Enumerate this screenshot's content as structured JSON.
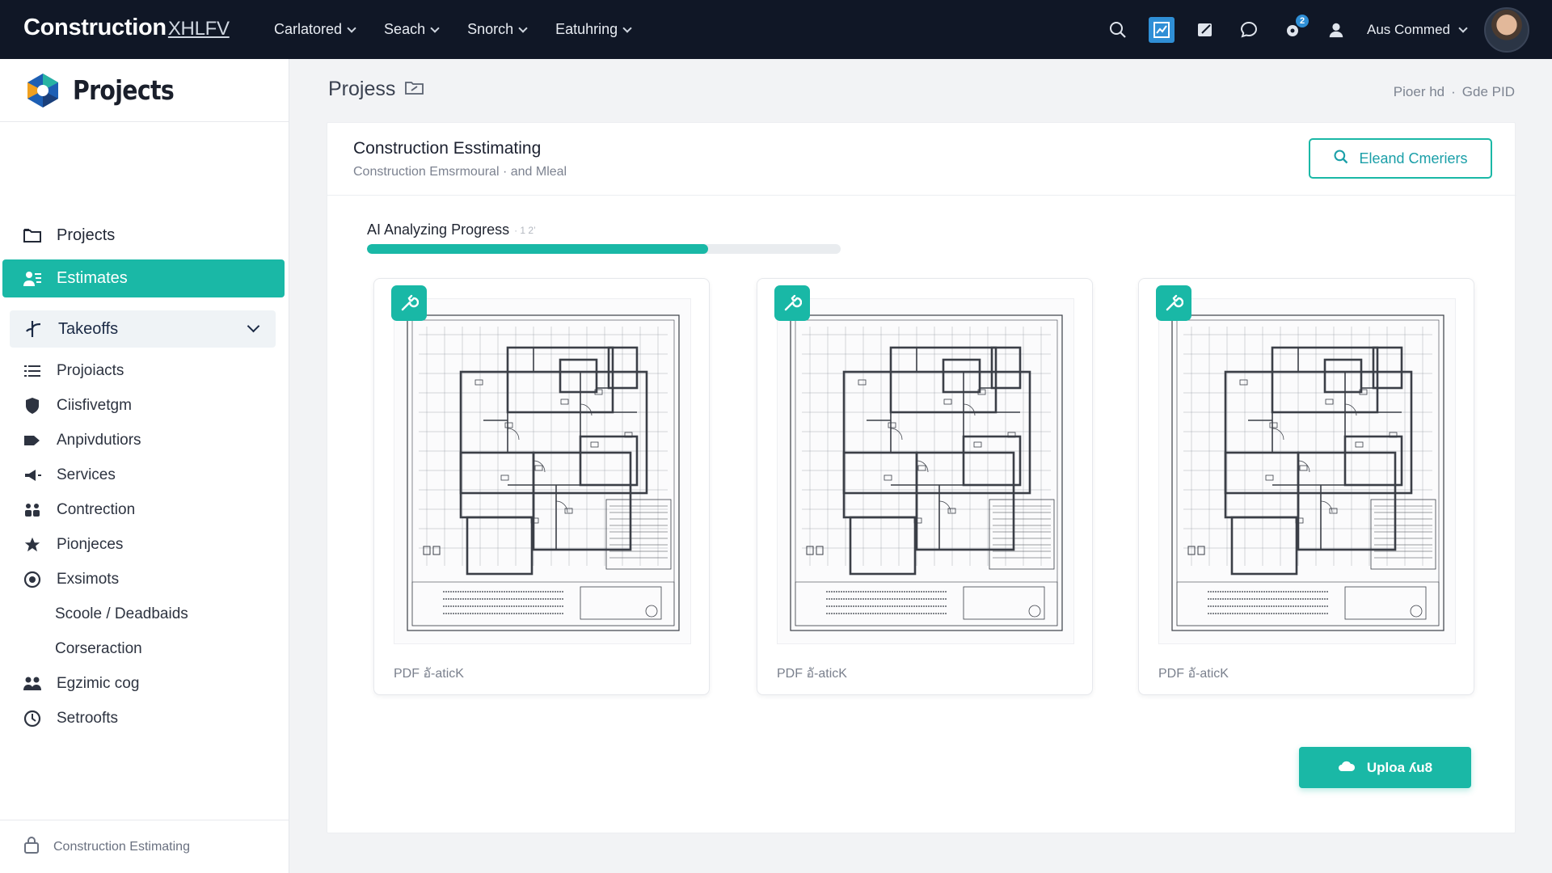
{
  "topbar": {
    "brand": "Construction",
    "brand_suffix": "XHLFV",
    "nav": [
      {
        "label": "Carlatored"
      },
      {
        "label": "Seach"
      },
      {
        "label": "Snorch"
      },
      {
        "label": "Eatuhring"
      }
    ],
    "notification_count": "2",
    "user_name": "Aus Commed"
  },
  "sidebar": {
    "title": "Projects",
    "items": [
      {
        "label": "Projects",
        "icon": "folder-icon"
      },
      {
        "label": "Estimates",
        "icon": "people-icon",
        "active": true
      },
      {
        "label": "Takeoffs",
        "icon": "branch-icon",
        "expanded": true
      }
    ],
    "sub_items": [
      {
        "label": "Projoiacts",
        "icon": "list-icon"
      },
      {
        "label": "Ciisfivetgm",
        "icon": "shield-icon"
      },
      {
        "label": "Anpivdutiors",
        "icon": "tag-icon"
      },
      {
        "label": "Services",
        "icon": "megaphone-icon"
      },
      {
        "label": "Contrection",
        "icon": "group-icon"
      },
      {
        "label": "Pionjeces",
        "icon": "star-icon"
      },
      {
        "label": "Exsimots",
        "icon": "globe-icon"
      },
      {
        "label": "Scoole / Deadbaids",
        "icon": ""
      },
      {
        "label": "Corseraction",
        "icon": ""
      },
      {
        "label": "Egzimic cog",
        "icon": "team-icon"
      },
      {
        "label": "Setroofts",
        "icon": "clock-icon"
      }
    ],
    "footer": "Construction Estimating"
  },
  "main": {
    "page_title": "Projess",
    "breadcrumb": [
      "Pioer hd",
      "Gde PID"
    ],
    "card": {
      "title": "Construction Esstimating",
      "subtitle": "Construction Emsrmoural · and Mleal",
      "action_button": "Eleand Cmeriers"
    },
    "progress": {
      "label": "AI Analyzing Progress",
      "sub_label": "· 1 2’",
      "value": 0.72
    },
    "plans": [
      {
        "caption": "PDF อั-aticK"
      },
      {
        "caption": "PDF อั-aticK"
      },
      {
        "caption": "PDF อั-aticK"
      }
    ],
    "upload_button": "Uploa ʎu8"
  },
  "colors": {
    "topbar": "#101726",
    "accent": "#1ab8a6",
    "accent_text": "#1a9fa8",
    "active_icon_bg": "#2f8fd6"
  }
}
